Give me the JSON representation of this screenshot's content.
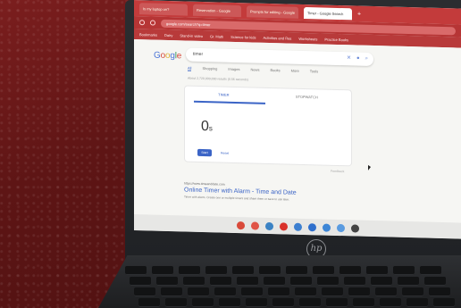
{
  "browser": {
    "tabs": [
      {
        "label": "Is my laptop on?"
      },
      {
        "label": "Reservation - Google"
      },
      {
        "label": "Prompts for editing - Google"
      },
      {
        "label": "Timer - Google Search",
        "active": true
      }
    ],
    "url": "google.com/search?q=timer",
    "bookmarks": [
      "Bookmarks",
      "Dairy",
      "Stand-in video",
      "Gr. Math",
      "Science for kids",
      "Activities and Res",
      "Worksheets",
      "Practice Books"
    ]
  },
  "google": {
    "logo": [
      "G",
      "o",
      "o",
      "g",
      "l",
      "e"
    ],
    "query": "timer",
    "result_tabs": [
      "All",
      "Shopping",
      "Images",
      "News",
      "Books",
      "More",
      "Tools"
    ],
    "selected_tab": "All",
    "stats": "About 2,720,000,000 results (0.56 seconds)",
    "timer": {
      "tabs": [
        "TIMER",
        "STOPWATCH"
      ],
      "value": "0",
      "unit": "s",
      "start_label": "Start",
      "reset_label": "Reset"
    },
    "feedback": "Feedback",
    "result": {
      "cite": "https://www.timeanddate.com",
      "title": "Online Timer with Alarm - Time and Date",
      "snippet": "Timer with alarm. Create one or multiple timers and share them or save to use later."
    }
  },
  "shelf_colors": [
    "#d94a3a",
    "#e05548",
    "#3b82c4",
    "#d9312a",
    "#3c7fd0",
    "#2f6fcc",
    "#3d86d6",
    "#5a9be0",
    "#444"
  ],
  "brand": "hp"
}
